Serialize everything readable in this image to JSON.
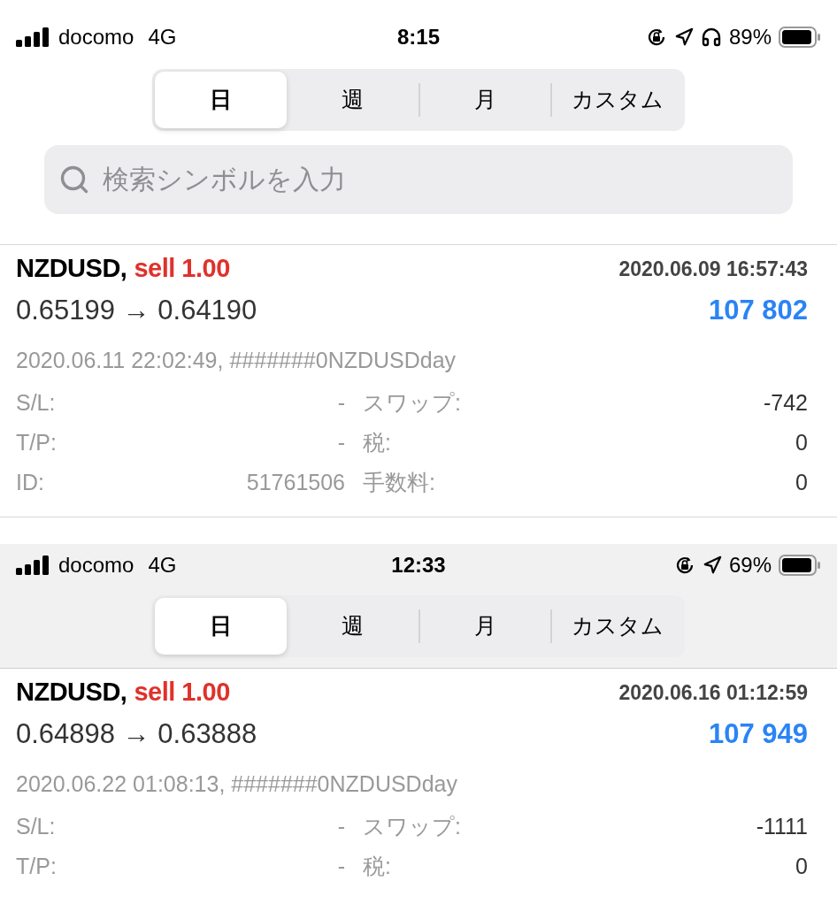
{
  "screens": [
    {
      "shaded": false,
      "status_bar": {
        "carrier": "docomo",
        "network": "4G",
        "time": "8:15",
        "battery": "89%",
        "icons": [
          {
            "kind": "lock"
          },
          {
            "kind": "location"
          },
          {
            "kind": "headphones"
          }
        ]
      },
      "segments": [
        {
          "label": "日",
          "selected": true
        },
        {
          "label": "週",
          "selected": false
        },
        {
          "label": "月",
          "selected": false
        },
        {
          "label": "カスタム",
          "selected": false
        }
      ],
      "search": {
        "placeholder": "検索シンボルを入力"
      },
      "trades": [
        {
          "symbol": "NZDUSD,",
          "side": "sell 1.00",
          "open_time": "2020.06.09 16:57:43",
          "prices": "0.65199 → 0.64190",
          "profit": "107 802",
          "close_info": "2020.06.11 22:02:49, #######0NZDUSDday",
          "details": [
            {
              "label": "S/L:",
              "value": "-",
              "label2": "スワップ:",
              "value2": "-742"
            },
            {
              "label": "T/P:",
              "value": "-",
              "label2": "税:",
              "value2": "0"
            },
            {
              "label": "ID:",
              "value": "51761506",
              "label2": "手数料:",
              "value2": "0"
            }
          ]
        }
      ]
    },
    {
      "shaded": true,
      "status_bar": {
        "carrier": "docomo",
        "network": "4G",
        "time": "12:33",
        "battery": "69%",
        "icons": [
          {
            "kind": "lock"
          },
          {
            "kind": "location"
          }
        ]
      },
      "segments": [
        {
          "label": "日",
          "selected": true
        },
        {
          "label": "週",
          "selected": false
        },
        {
          "label": "月",
          "selected": false
        },
        {
          "label": "カスタム",
          "selected": false
        }
      ],
      "trades": [
        {
          "symbol": "NZDUSD,",
          "side": "sell 1.00",
          "open_time": "2020.06.16 01:12:59",
          "prices": "0.64898 → 0.63888",
          "profit": "107 949",
          "close_info": "2020.06.22 01:08:13, #######0NZDUSDday",
          "details": [
            {
              "label": "S/L:",
              "value": "-",
              "label2": "スワップ:",
              "value2": "-1111"
            },
            {
              "label": "T/P:",
              "value": "-",
              "label2": "税:",
              "value2": "0"
            }
          ]
        }
      ]
    }
  ]
}
